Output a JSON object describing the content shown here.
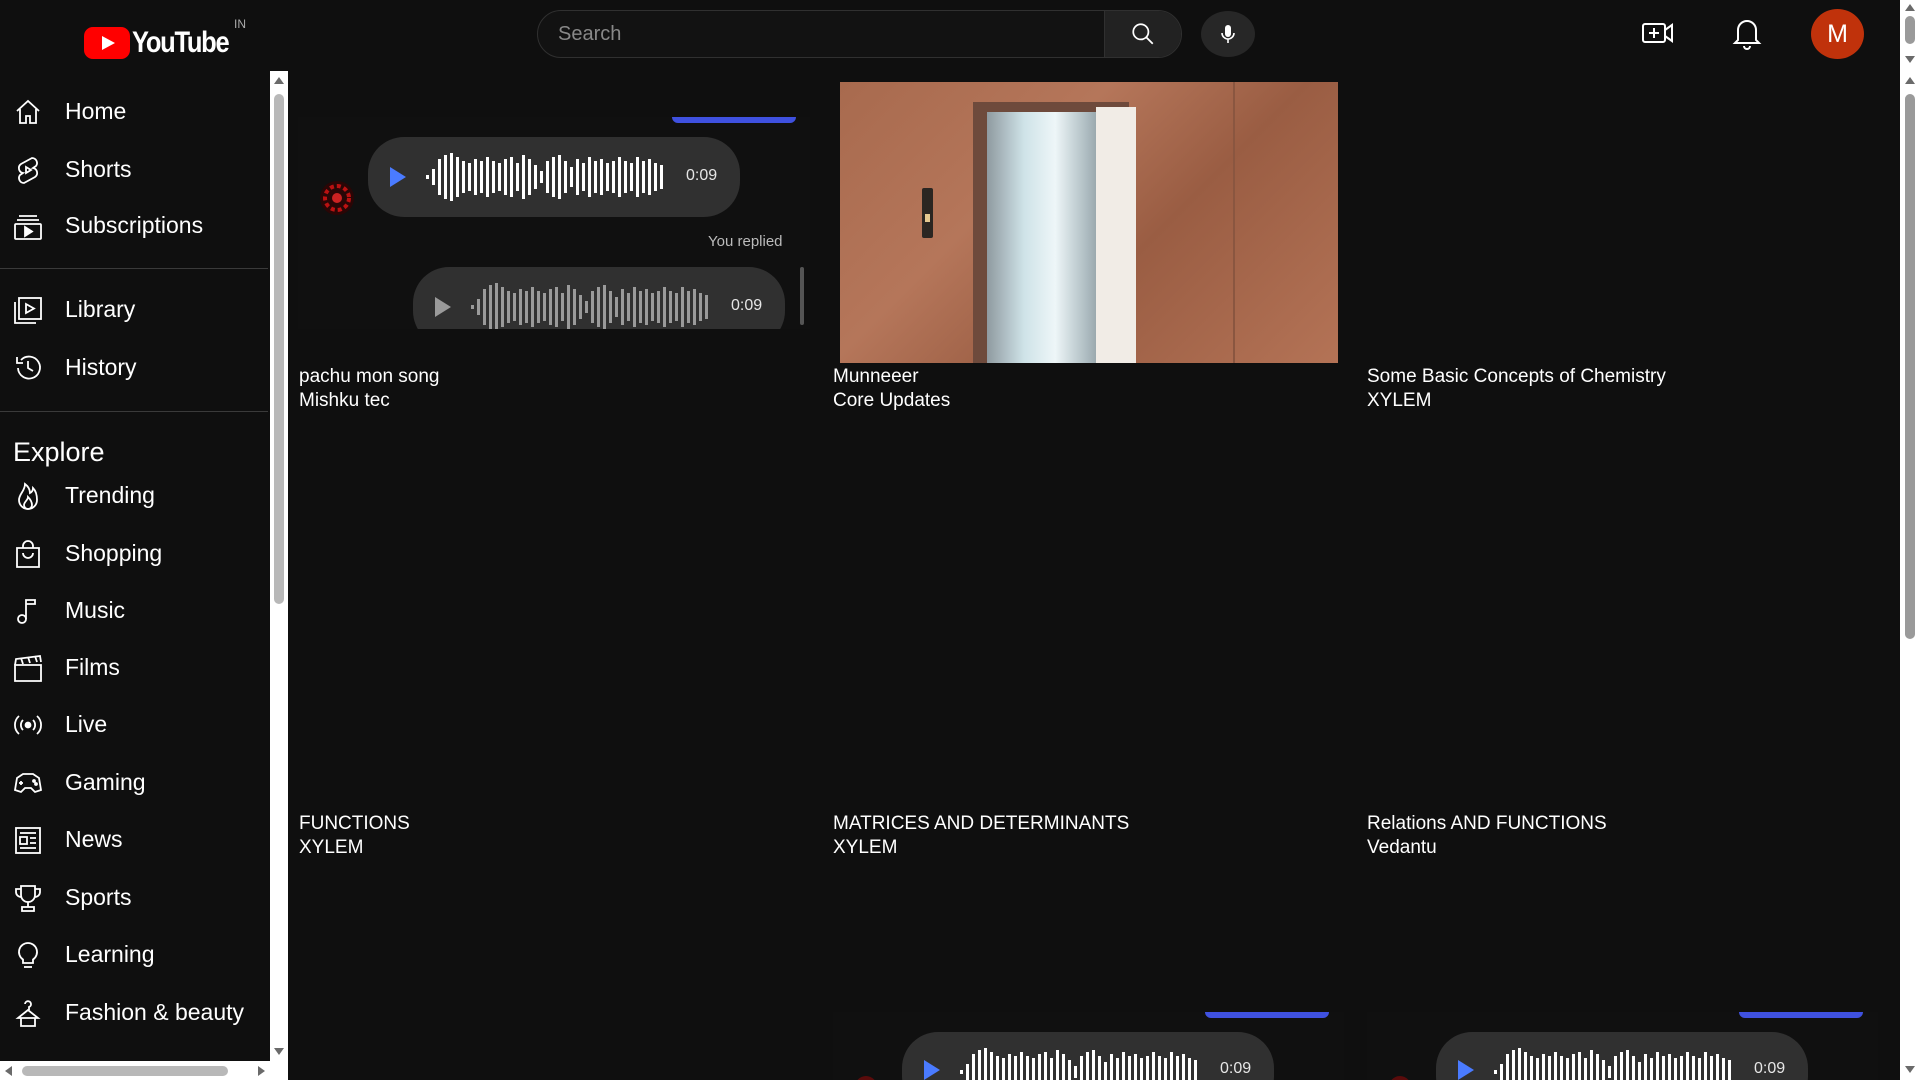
{
  "header": {
    "logo_text": "YouTube",
    "country_code": "IN",
    "search_placeholder": "Search",
    "avatar_letter": "M"
  },
  "sidebar": {
    "primary": [
      {
        "label": "Home",
        "icon": "home-icon"
      },
      {
        "label": "Shorts",
        "icon": "shorts-icon"
      },
      {
        "label": "Subscriptions",
        "icon": "subscriptions-icon"
      }
    ],
    "secondary": [
      {
        "label": "Library",
        "icon": "library-icon"
      },
      {
        "label": "History",
        "icon": "history-icon"
      }
    ],
    "explore_title": "Explore",
    "explore": [
      {
        "label": "Trending",
        "icon": "trending-icon"
      },
      {
        "label": "Shopping",
        "icon": "shopping-icon"
      },
      {
        "label": "Music",
        "icon": "music-icon"
      },
      {
        "label": "Films",
        "icon": "films-icon"
      },
      {
        "label": "Live",
        "icon": "live-icon"
      },
      {
        "label": "Gaming",
        "icon": "gaming-icon"
      },
      {
        "label": "News",
        "icon": "news-icon"
      },
      {
        "label": "Sports",
        "icon": "sports-icon"
      },
      {
        "label": "Learning",
        "icon": "learning-icon"
      },
      {
        "label": "Fashion & beauty",
        "icon": "fashion-icon"
      }
    ]
  },
  "videos": [
    {
      "title": "pachu mon song",
      "channel": "Mishku tec",
      "voice_duration": "0:09",
      "replied_label": "You replied",
      "reply_duration": "0:09"
    },
    {
      "title": "Munneeer",
      "channel": "Core Updates"
    },
    {
      "title": "Some Basic Concepts of Chemistry",
      "channel": "XYLEM"
    },
    {
      "title": "FUNCTIONS",
      "channel": "XYLEM"
    },
    {
      "title": "MATRICES AND DETERMINANTS",
      "channel": "XYLEM"
    },
    {
      "title": "Relations AND FUNCTIONS",
      "channel": "Vedantu"
    },
    {
      "voice_duration": "0:09"
    },
    {
      "voice_duration": "0:09"
    }
  ],
  "colors": {
    "background": "#0f0f0f",
    "brand_red": "#ff0000",
    "avatar_bg": "#c0320b",
    "voice_play": "#4a7bff"
  }
}
